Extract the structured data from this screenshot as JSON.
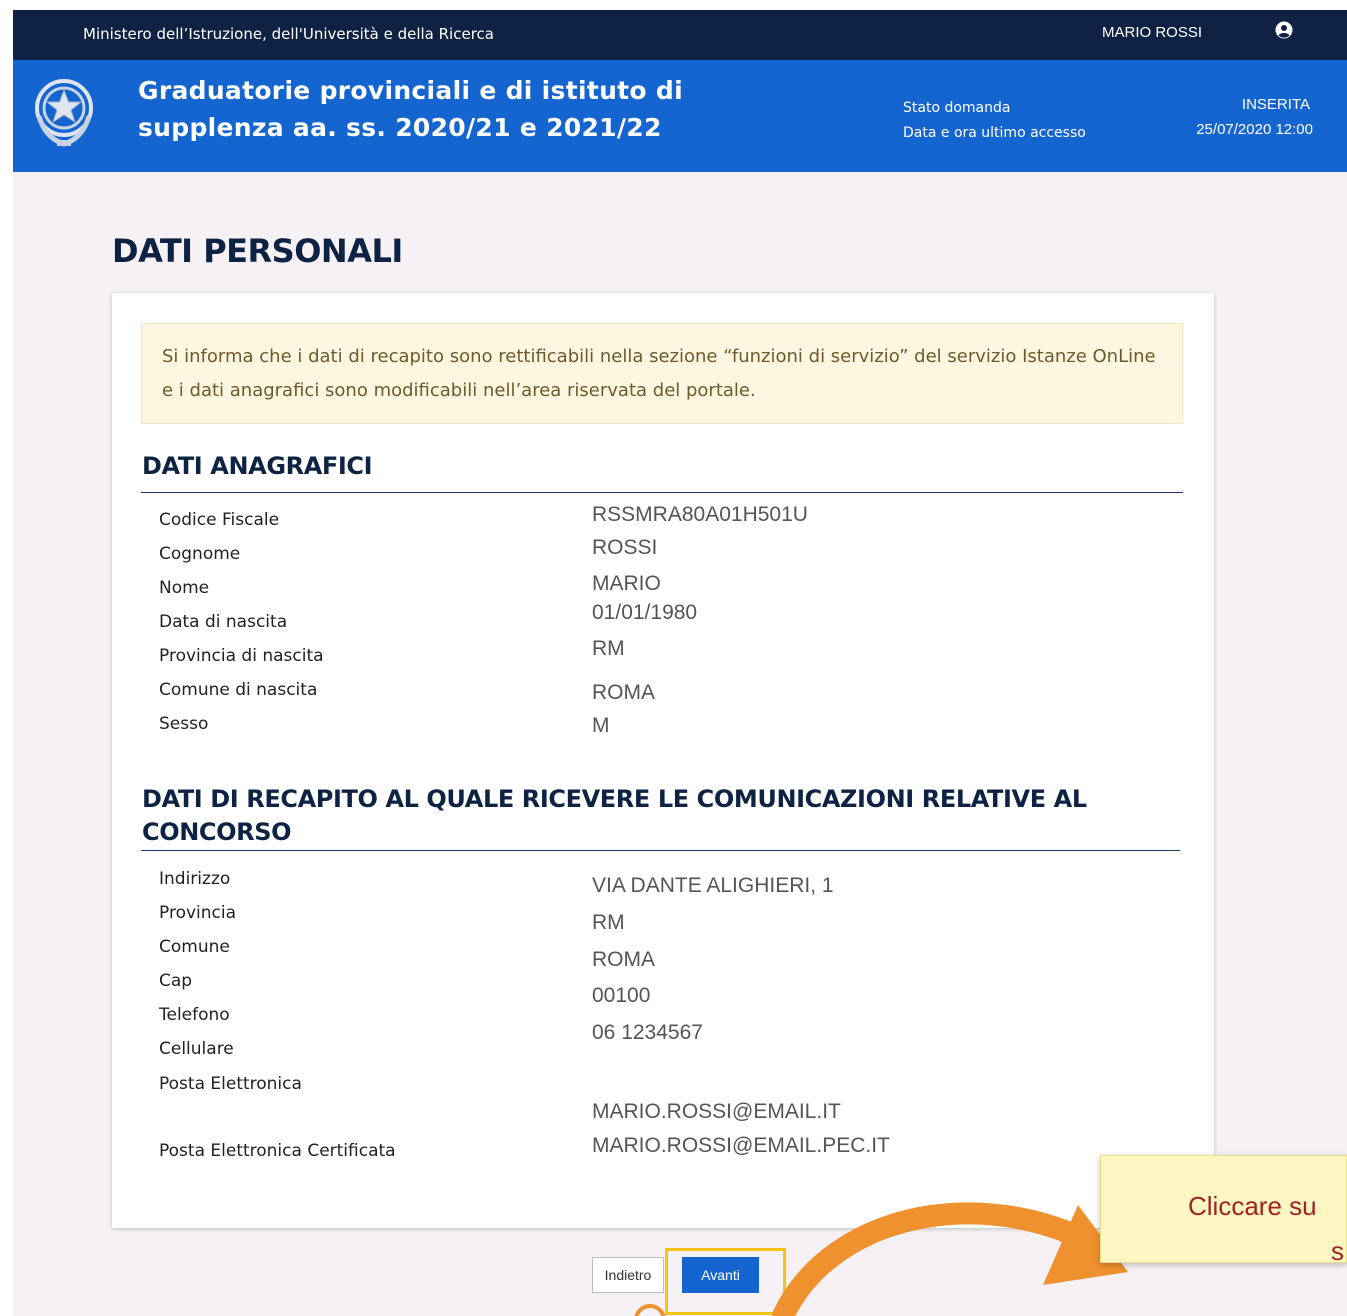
{
  "topbar": {
    "ministry": "Ministero dell’Istruzione, dell'Università e della Ricerca",
    "user_name": "MARIO ROSSI",
    "user_icon": "user-circle-icon"
  },
  "header": {
    "emblem_icon": "italian-republic-emblem",
    "title": "Graduatorie provinciali e di istituto di supplenza aa. ss. 2020/21 e 2021/22",
    "status_label": "Stato domanda",
    "status_value": "INSERITA",
    "last_access_label": "Data e ora ultimo accesso",
    "last_access_value": "25/07/2020 12:00"
  },
  "page_title": "DATI PERSONALI",
  "notice": "Si informa che i dati di recapito sono rettificabili nella sezione “funzioni di servizio” del servizio Istanze OnLine e i dati anagrafici sono modificabili nell’area riservata del portale.",
  "anagrafici": {
    "title": "DATI ANAGRAFICI",
    "rows": [
      {
        "label": "Codice Fiscale",
        "value": "RSSMRA80A01H501U"
      },
      {
        "label": "Cognome",
        "value": "ROSSI"
      },
      {
        "label": "Nome",
        "value": "MARIO"
      },
      {
        "label": "Data di nascita",
        "value": "01/01/1980"
      },
      {
        "label": "Provincia di nascita",
        "value": "RM"
      },
      {
        "label": "Comune di nascita",
        "value": "ROMA"
      },
      {
        "label": "Sesso",
        "value": "M"
      }
    ]
  },
  "recapito": {
    "title": "DATI DI RECAPITO AL QUALE RICEVERE LE COMUNICAZIONI RELATIVE AL CONCORSO",
    "rows": [
      {
        "label": "Indirizzo",
        "value": "VIA DANTE ALIGHIERI, 1"
      },
      {
        "label": "Provincia",
        "value": "RM"
      },
      {
        "label": "Comune",
        "value": "ROMA"
      },
      {
        "label": "Cap",
        "value": "00100"
      },
      {
        "label": "Telefono",
        "value": "06 1234567"
      },
      {
        "label": "Cellulare",
        "value": ""
      },
      {
        "label": "Posta Elettronica",
        "value": "MARIO.ROSSI@EMAIL.IT"
      },
      {
        "label": "Posta Elettronica Certificata",
        "value": "MARIO.ROSSI@EMAIL.PEC.IT"
      }
    ]
  },
  "buttons": {
    "back": "Indietro",
    "next": "Avanti"
  },
  "tooltip": {
    "line1": "Cliccare su",
    "line2": "s"
  },
  "colors": {
    "topbar": "#0f2244",
    "header": "#1565d1",
    "highlight": "#f4c314",
    "arrow": "#f0912f",
    "tooltip_text": "#a02424"
  }
}
